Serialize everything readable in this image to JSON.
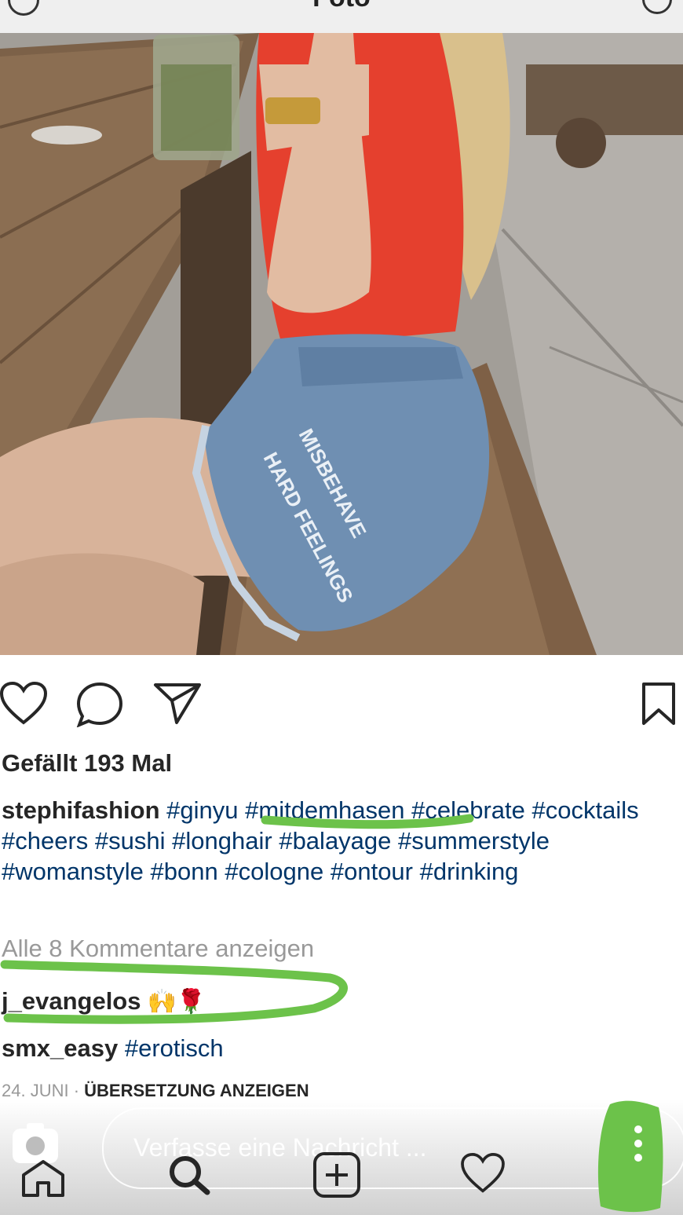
{
  "header": {
    "title": "Foto"
  },
  "post": {
    "likes": "Gefällt 193 Mal",
    "caption": {
      "username": "stephifashion",
      "hashtags": [
        "#ginyu",
        "#mitdemhasen",
        "#celebrate",
        "#cocktails",
        "#cheers",
        "#sushi",
        "#longhair",
        "#balayage",
        "#summerstyle",
        "#womanstyle",
        "#bonn",
        "#cologne",
        "#ontour",
        "#drinking"
      ]
    },
    "view_all_comments": "Alle 8 Kommentare anzeigen",
    "comments": [
      {
        "username": "j_evangelos",
        "text": "🙌🌹"
      },
      {
        "username": "smx_easy",
        "text": "#erotisch"
      }
    ],
    "date": "24. JUNI",
    "separator": " · ",
    "translate": "ÜBERSETZUNG ANZEIGEN",
    "skirt_text": [
      "MISBEHAVE",
      "HARD FEELINGS"
    ]
  },
  "message": {
    "placeholder": "Verfasse eine Nachricht ..."
  },
  "colors": {
    "hashtag": "#003569",
    "annotation_green": "#6cc24a",
    "muted": "#999999"
  },
  "icons": [
    "back-icon",
    "more-icon",
    "heart-icon",
    "comment-icon",
    "share-icon",
    "bookmark-icon",
    "camera-icon",
    "home-icon",
    "search-icon",
    "add-icon",
    "heart-tab-icon",
    "menu-dots-icon"
  ]
}
